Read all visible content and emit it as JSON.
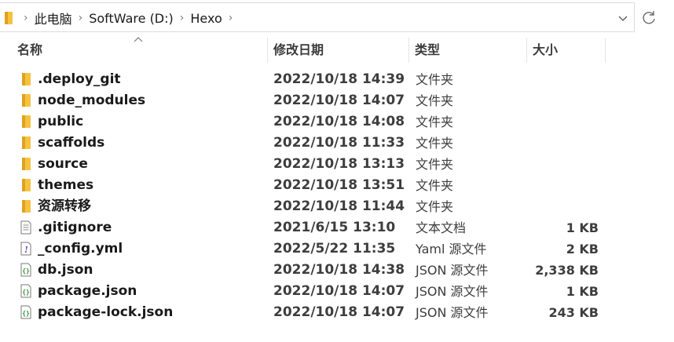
{
  "breadcrumb": [
    "此电脑",
    "SoftWare (D:)",
    "Hexo"
  ],
  "columns": {
    "name": "名称",
    "date": "修改日期",
    "type": "类型",
    "size": "大小"
  },
  "colors": {
    "folder": "#f5c242",
    "folder_dark": "#e0a21f",
    "accent": "#0067c0"
  },
  "files": [
    {
      "name": ".deploy_git",
      "date": "2022/10/18 14:39",
      "type": "文件夹",
      "size": "",
      "icon": "folder-icon"
    },
    {
      "name": "node_modules",
      "date": "2022/10/18 14:07",
      "type": "文件夹",
      "size": "",
      "icon": "folder-icon"
    },
    {
      "name": "public",
      "date": "2022/10/18 14:08",
      "type": "文件夹",
      "size": "",
      "icon": "folder-icon"
    },
    {
      "name": "scaffolds",
      "date": "2022/10/18 11:33",
      "type": "文件夹",
      "size": "",
      "icon": "folder-icon"
    },
    {
      "name": "source",
      "date": "2022/10/18 13:13",
      "type": "文件夹",
      "size": "",
      "icon": "folder-icon"
    },
    {
      "name": "themes",
      "date": "2022/10/18 13:51",
      "type": "文件夹",
      "size": "",
      "icon": "folder-icon"
    },
    {
      "name": "资源转移",
      "date": "2022/10/18 11:44",
      "type": "文件夹",
      "size": "",
      "icon": "folder-icon"
    },
    {
      "name": ".gitignore",
      "date": "2021/6/15 13:10",
      "type": "文本文档",
      "size": "1 KB",
      "icon": "text-file-icon"
    },
    {
      "name": "_config.yml",
      "date": "2022/5/22 11:35",
      "type": "Yaml 源文件",
      "size": "2 KB",
      "icon": "yaml-file-icon"
    },
    {
      "name": "db.json",
      "date": "2022/10/18 14:38",
      "type": "JSON 源文件",
      "size": "2,338 KB",
      "icon": "json-file-icon"
    },
    {
      "name": "package.json",
      "date": "2022/10/18 14:07",
      "type": "JSON 源文件",
      "size": "1 KB",
      "icon": "json-file-icon"
    },
    {
      "name": "package-lock.json",
      "date": "2022/10/18 14:07",
      "type": "JSON 源文件",
      "size": "243 KB",
      "icon": "json-file-icon"
    }
  ]
}
